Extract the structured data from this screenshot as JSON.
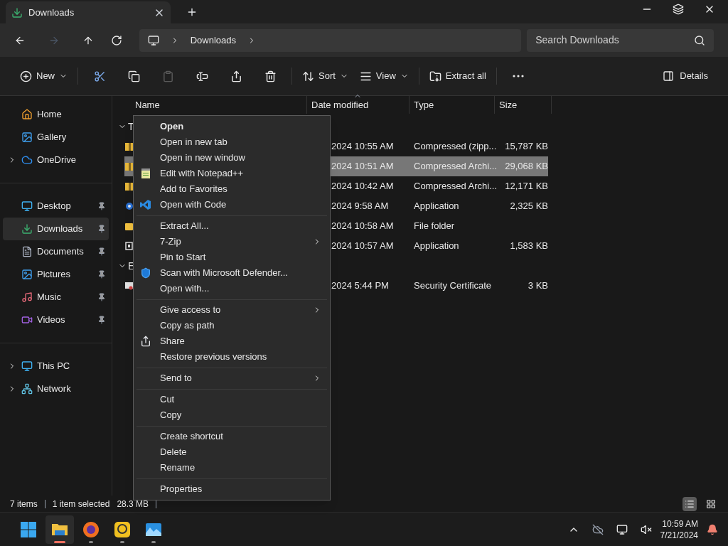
{
  "tab": {
    "title": "Downloads",
    "selected": true
  },
  "address": {
    "crumbs": [
      "Downloads"
    ],
    "search_placeholder": "Search Downloads"
  },
  "toolbar": [
    {
      "label": "New",
      "dropdown": true,
      "disabled": false
    },
    {
      "disabled": false
    },
    {
      "disabled": false
    },
    {
      "disabled": true
    },
    {
      "disabled": false
    },
    {
      "disabled": false
    },
    {
      "disabled": false
    },
    {
      "label": "Sort",
      "dropdown": true,
      "disabled": false
    },
    {
      "label": "View",
      "dropdown": true,
      "disabled": false
    },
    {
      "label": "Extract all",
      "dropdown": false,
      "disabled": false
    },
    {
      "disabled": false
    }
  ],
  "details_button": "Details",
  "sidebar": {
    "groups": [
      [
        {
          "label": "Home",
          "expandable": false,
          "pinned": false,
          "selected": false
        },
        {
          "label": "Gallery",
          "expandable": false,
          "pinned": false,
          "selected": false
        },
        {
          "label": "OneDrive",
          "expandable": true,
          "pinned": false,
          "selected": false
        }
      ],
      [
        {
          "label": "Desktop",
          "expandable": false,
          "pinned": true,
          "selected": false
        },
        {
          "label": "Downloads",
          "expandable": false,
          "pinned": true,
          "selected": true
        },
        {
          "label": "Documents",
          "expandable": false,
          "pinned": true,
          "selected": false
        },
        {
          "label": "Pictures",
          "expandable": false,
          "pinned": true,
          "selected": false
        },
        {
          "label": "Music",
          "expandable": false,
          "pinned": true,
          "selected": false
        },
        {
          "label": "Videos",
          "expandable": false,
          "pinned": true,
          "selected": false
        }
      ],
      [
        {
          "label": "This PC",
          "expandable": true,
          "pinned": false,
          "selected": false
        },
        {
          "label": "Network",
          "expandable": true,
          "pinned": false,
          "selected": false
        }
      ]
    ]
  },
  "table": {
    "columns": [
      "Name",
      "Date modified",
      "Type",
      "Size"
    ],
    "groups": [
      {
        "header": "T",
        "rows": [
          {
            "date": "2024 10:55 AM",
            "type": "Compressed (zipp...",
            "size": "15,787 KB",
            "selected": false
          },
          {
            "date": "2024 10:51 AM",
            "type": "Compressed Archi...",
            "size": "29,068 KB",
            "selected": true
          },
          {
            "date": "2024 10:42 AM",
            "type": "Compressed Archi...",
            "size": "12,171 KB",
            "selected": false
          },
          {
            "date": "2024 9:58 AM",
            "type": "Application",
            "size": "2,325 KB",
            "selected": false
          },
          {
            "date": "2024 10:58 AM",
            "type": "File folder",
            "selected": false
          },
          {
            "date": "2024 10:57 AM",
            "type": "Application",
            "size": "1,583 KB",
            "selected": false
          }
        ]
      },
      {
        "header": "E",
        "rows": [
          {
            "date": "2024 5:44 PM",
            "type": "Security Certificate",
            "size": "3 KB",
            "selected": false
          }
        ]
      }
    ]
  },
  "context_menu": [
    {
      "kind": "item",
      "label": "Open",
      "emphasized": true,
      "submenu": false
    },
    {
      "kind": "item",
      "label": "Open in new tab",
      "emphasized": false,
      "submenu": false
    },
    {
      "kind": "item",
      "label": "Open in new window",
      "emphasized": false,
      "submenu": false
    },
    {
      "kind": "item",
      "label": "Edit with Notepad++",
      "emphasized": false,
      "submenu": false
    },
    {
      "kind": "item",
      "label": "Add to Favorites",
      "emphasized": false,
      "submenu": false
    },
    {
      "kind": "item",
      "label": "Open with Code",
      "emphasized": false,
      "submenu": false
    },
    {
      "kind": "separator"
    },
    {
      "kind": "item",
      "label": "Extract All...",
      "emphasized": false,
      "submenu": false
    },
    {
      "kind": "item",
      "label": "7-Zip",
      "emphasized": false,
      "submenu": true
    },
    {
      "kind": "item",
      "label": "Pin to Start",
      "emphasized": false,
      "submenu": false
    },
    {
      "kind": "item",
      "label": "Scan with Microsoft Defender...",
      "emphasized": false,
      "submenu": false
    },
    {
      "kind": "item",
      "label": "Open with...",
      "emphasized": false,
      "submenu": false
    },
    {
      "kind": "separator"
    },
    {
      "kind": "item",
      "label": "Give access to",
      "emphasized": false,
      "submenu": true
    },
    {
      "kind": "item",
      "label": "Copy as path",
      "emphasized": false,
      "submenu": false
    },
    {
      "kind": "item",
      "label": "Share",
      "emphasized": false,
      "submenu": false
    },
    {
      "kind": "item",
      "label": "Restore previous versions",
      "emphasized": false,
      "submenu": false
    },
    {
      "kind": "separator"
    },
    {
      "kind": "item",
      "label": "Send to",
      "emphasized": false,
      "submenu": true
    },
    {
      "kind": "separator"
    },
    {
      "kind": "item",
      "label": "Cut",
      "emphasized": false,
      "submenu": false
    },
    {
      "kind": "item",
      "label": "Copy",
      "emphasized": false,
      "submenu": false
    },
    {
      "kind": "separator"
    },
    {
      "kind": "item",
      "label": "Create shortcut",
      "emphasized": false,
      "submenu": false
    },
    {
      "kind": "item",
      "label": "Delete",
      "emphasized": false,
      "submenu": false
    },
    {
      "kind": "item",
      "label": "Rename",
      "emphasized": false,
      "submenu": false
    },
    {
      "kind": "separator"
    },
    {
      "kind": "item",
      "label": "Properties",
      "emphasized": false,
      "submenu": false
    }
  ],
  "status_bar": {
    "count": "7 items",
    "selection": "1 item selected",
    "selection_size": "28.3 MB",
    "view_modes": [
      {
        "selected": true
      },
      {
        "selected": false
      }
    ]
  },
  "taskbar": {
    "apps": [
      {
        "selected": false
      },
      {
        "selected": true
      },
      {
        "selected": false
      },
      {
        "selected": false
      },
      {
        "selected": false
      }
    ],
    "time": "10:59 AM",
    "date": "7/21/2024"
  }
}
